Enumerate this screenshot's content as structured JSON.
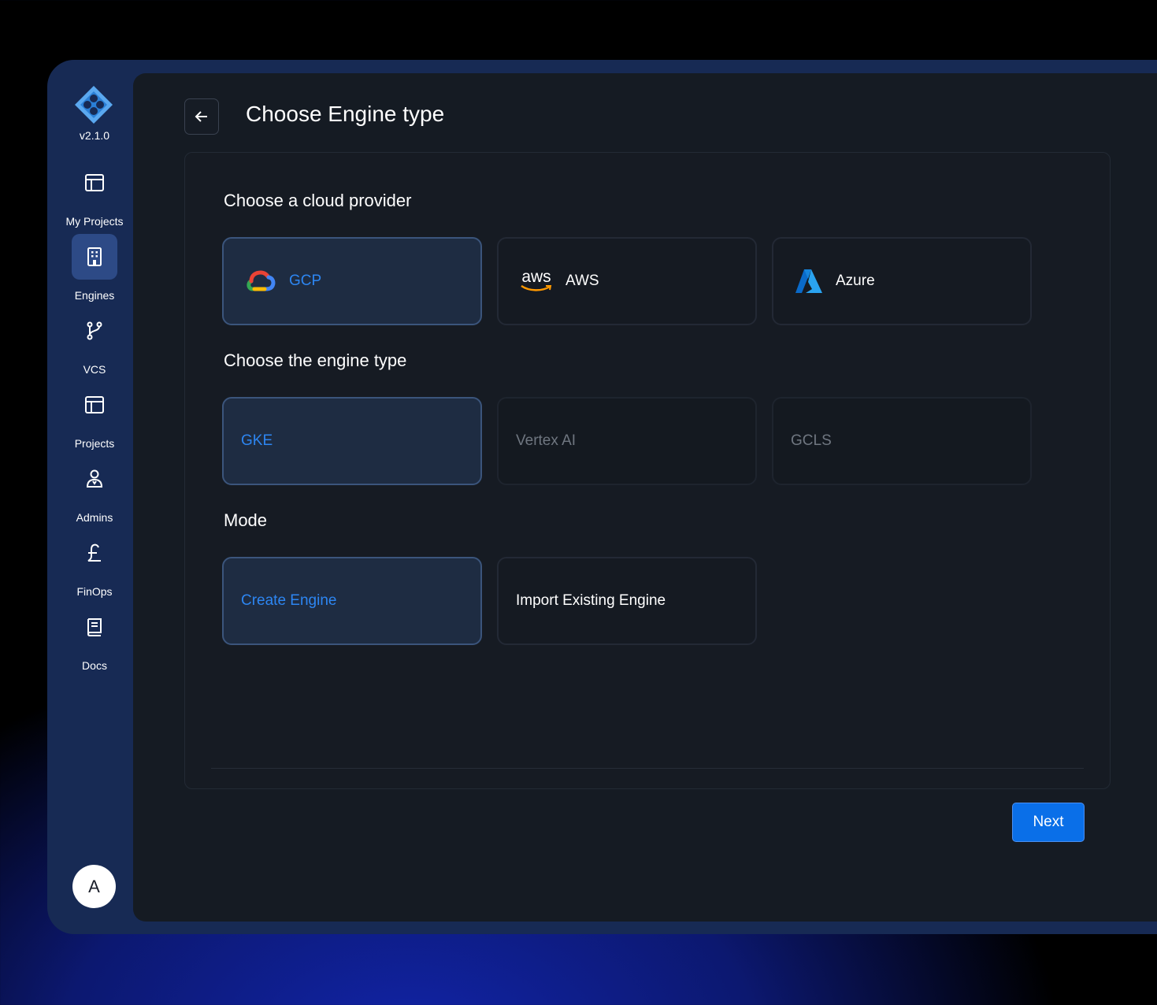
{
  "sidebar": {
    "version": "v2.1.0",
    "items": [
      {
        "label": "My Projects",
        "icon": "layout-icon"
      },
      {
        "label": "Engines",
        "icon": "building-icon",
        "active": true
      },
      {
        "label": "VCS",
        "icon": "git-branch-icon"
      },
      {
        "label": "Projects",
        "icon": "layout-icon"
      },
      {
        "label": "Admins",
        "icon": "admin-user-icon"
      },
      {
        "label": "FinOps",
        "icon": "pound-icon"
      },
      {
        "label": "Docs",
        "icon": "book-icon"
      }
    ],
    "avatar_initial": "A"
  },
  "header": {
    "title": "Choose Engine type"
  },
  "sections": {
    "provider": {
      "title": "Choose a cloud provider",
      "options": [
        {
          "label": "GCP",
          "icon": "gcp-logo",
          "state": "selected"
        },
        {
          "label": "AWS",
          "icon": "aws-logo",
          "icon_text": "aws",
          "state": "default"
        },
        {
          "label": "Azure",
          "icon": "azure-logo",
          "state": "default"
        }
      ]
    },
    "engine_type": {
      "title": "Choose the engine type",
      "options": [
        {
          "label": "GKE",
          "state": "selected"
        },
        {
          "label": "Vertex AI",
          "state": "disabled"
        },
        {
          "label": "GCLS",
          "state": "disabled"
        }
      ]
    },
    "mode": {
      "title": "Mode",
      "options": [
        {
          "label": "Create Engine",
          "state": "selected"
        },
        {
          "label": "Import Existing Engine",
          "state": "default"
        }
      ]
    }
  },
  "actions": {
    "next_label": "Next"
  },
  "colors": {
    "accent": "#0a6fe8",
    "selected_text": "#2d86f2",
    "sidebar_bg": "#172a54",
    "main_bg": "#151b23"
  }
}
